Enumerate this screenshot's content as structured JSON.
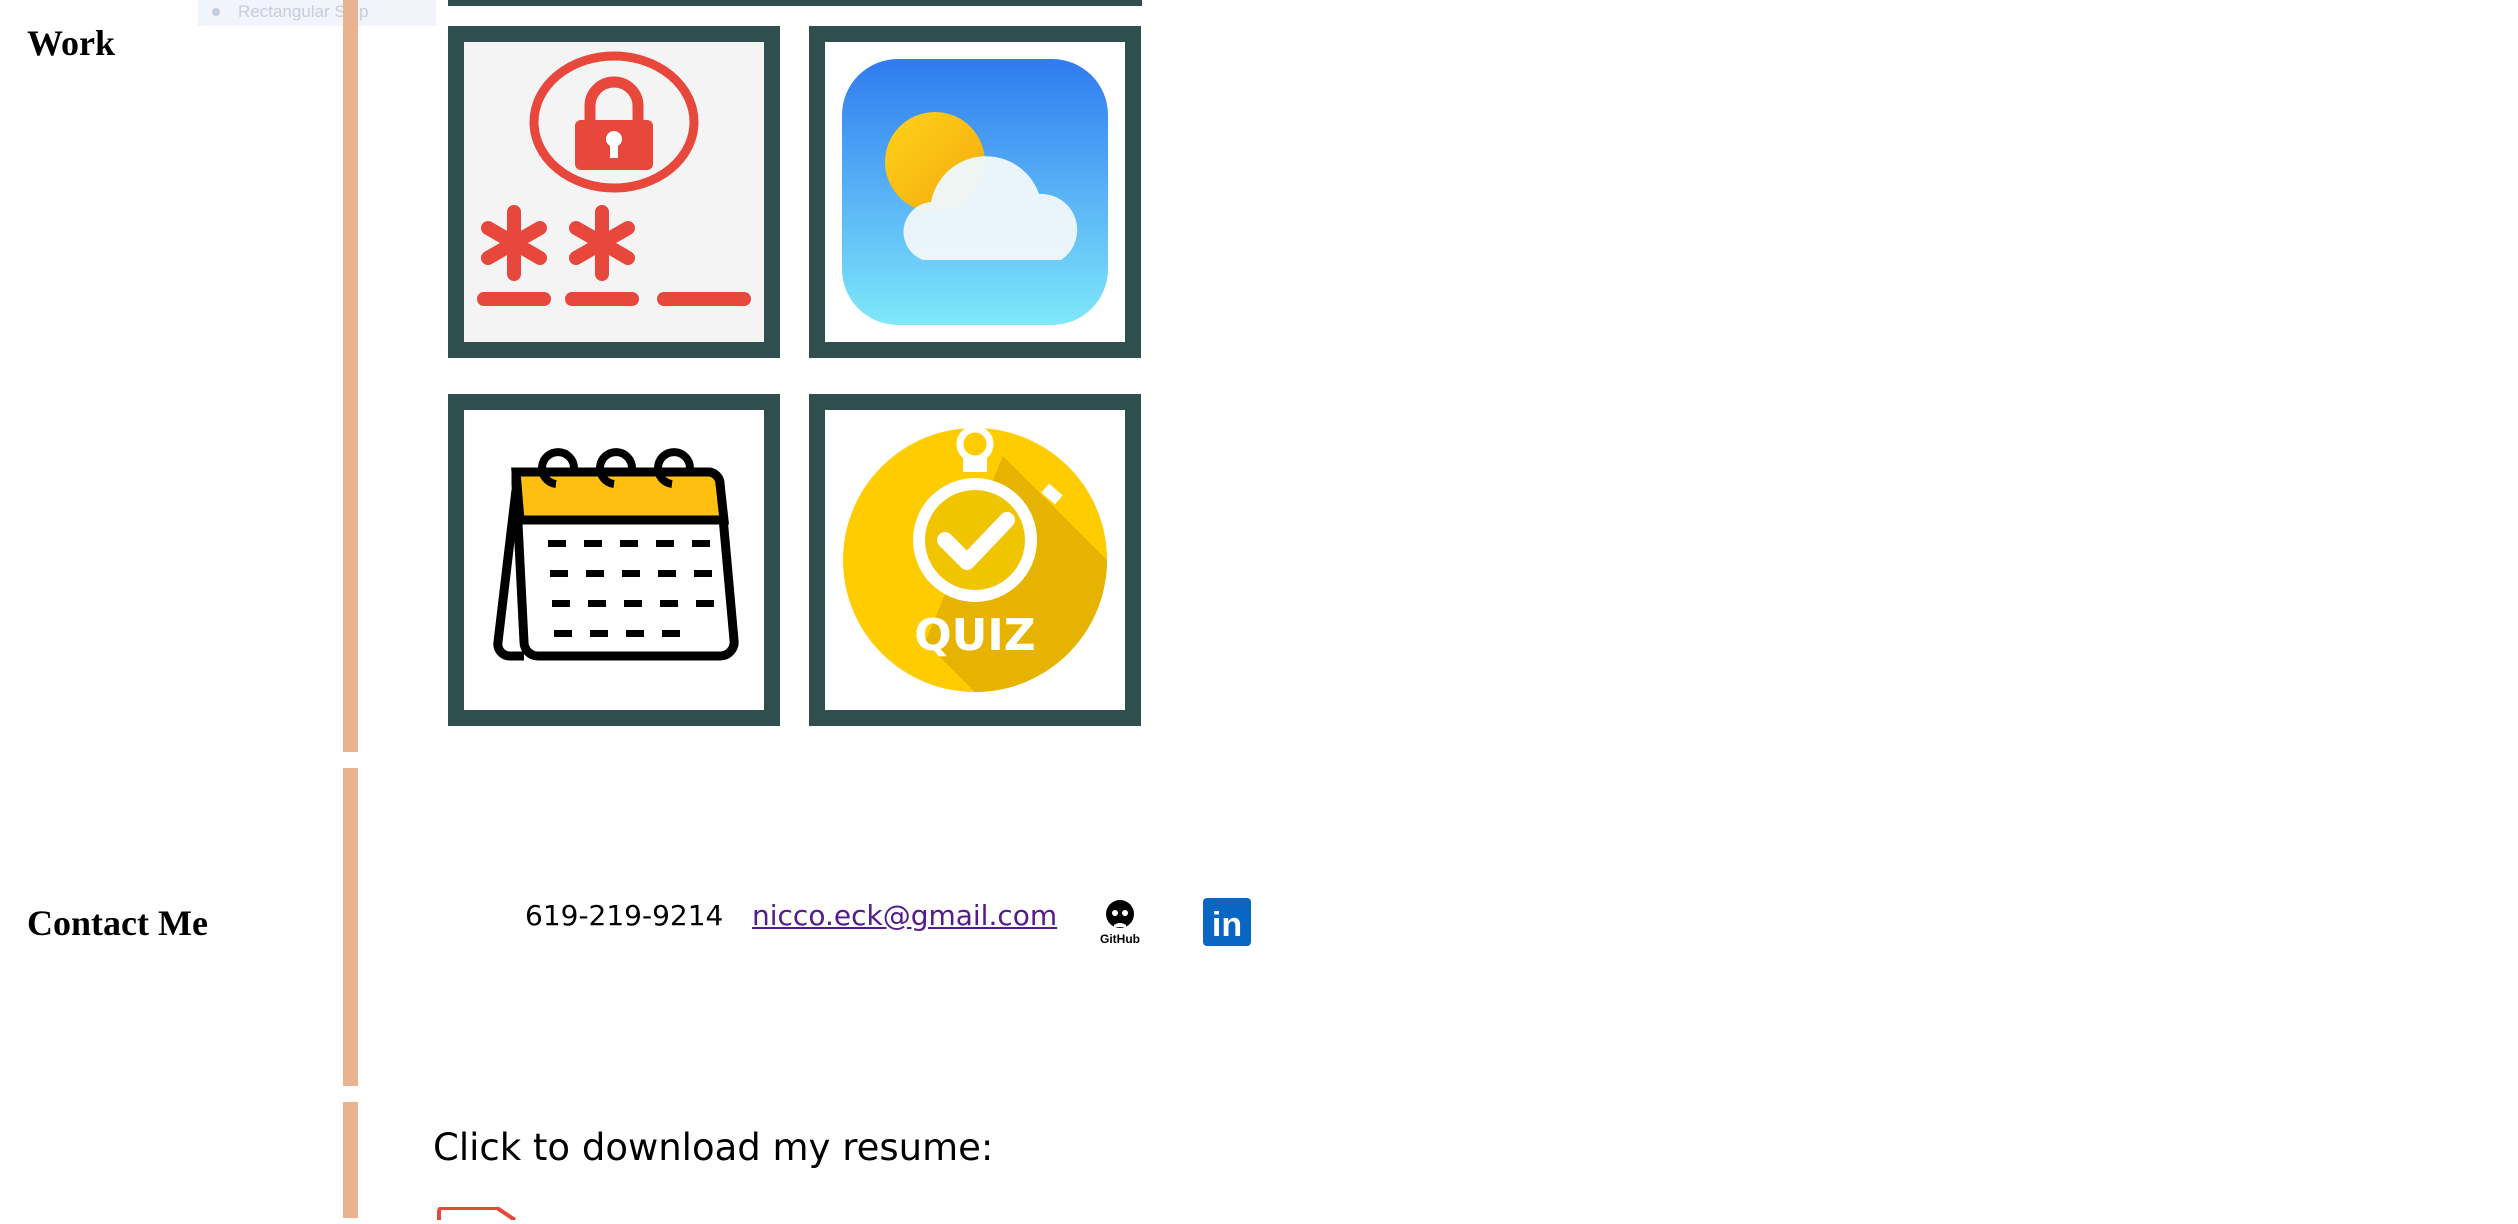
{
  "snip": {
    "label": "Rectangular Snip"
  },
  "sections": {
    "work": {
      "heading": "Work"
    },
    "contact": {
      "heading": "Contact Me",
      "phone": "619-219-9214",
      "email": "nicco.eck@gmail.com",
      "github_icon_text": "GitHub",
      "linkedin_icon_text": "in"
    },
    "resume": {
      "label": "Click to download my resume:"
    }
  },
  "projects": [
    {
      "icon": "password-lock-icon"
    },
    {
      "icon": "weather-icon"
    },
    {
      "icon": "calendar-icon"
    },
    {
      "icon": "quiz-stopwatch-icon"
    }
  ],
  "quiz_text": "QUIZ",
  "colors": {
    "accent_bar": "#e8b390",
    "tile_border": "#2f4f4f",
    "link": "#551a8b",
    "linkedin": "#0a66c2"
  }
}
